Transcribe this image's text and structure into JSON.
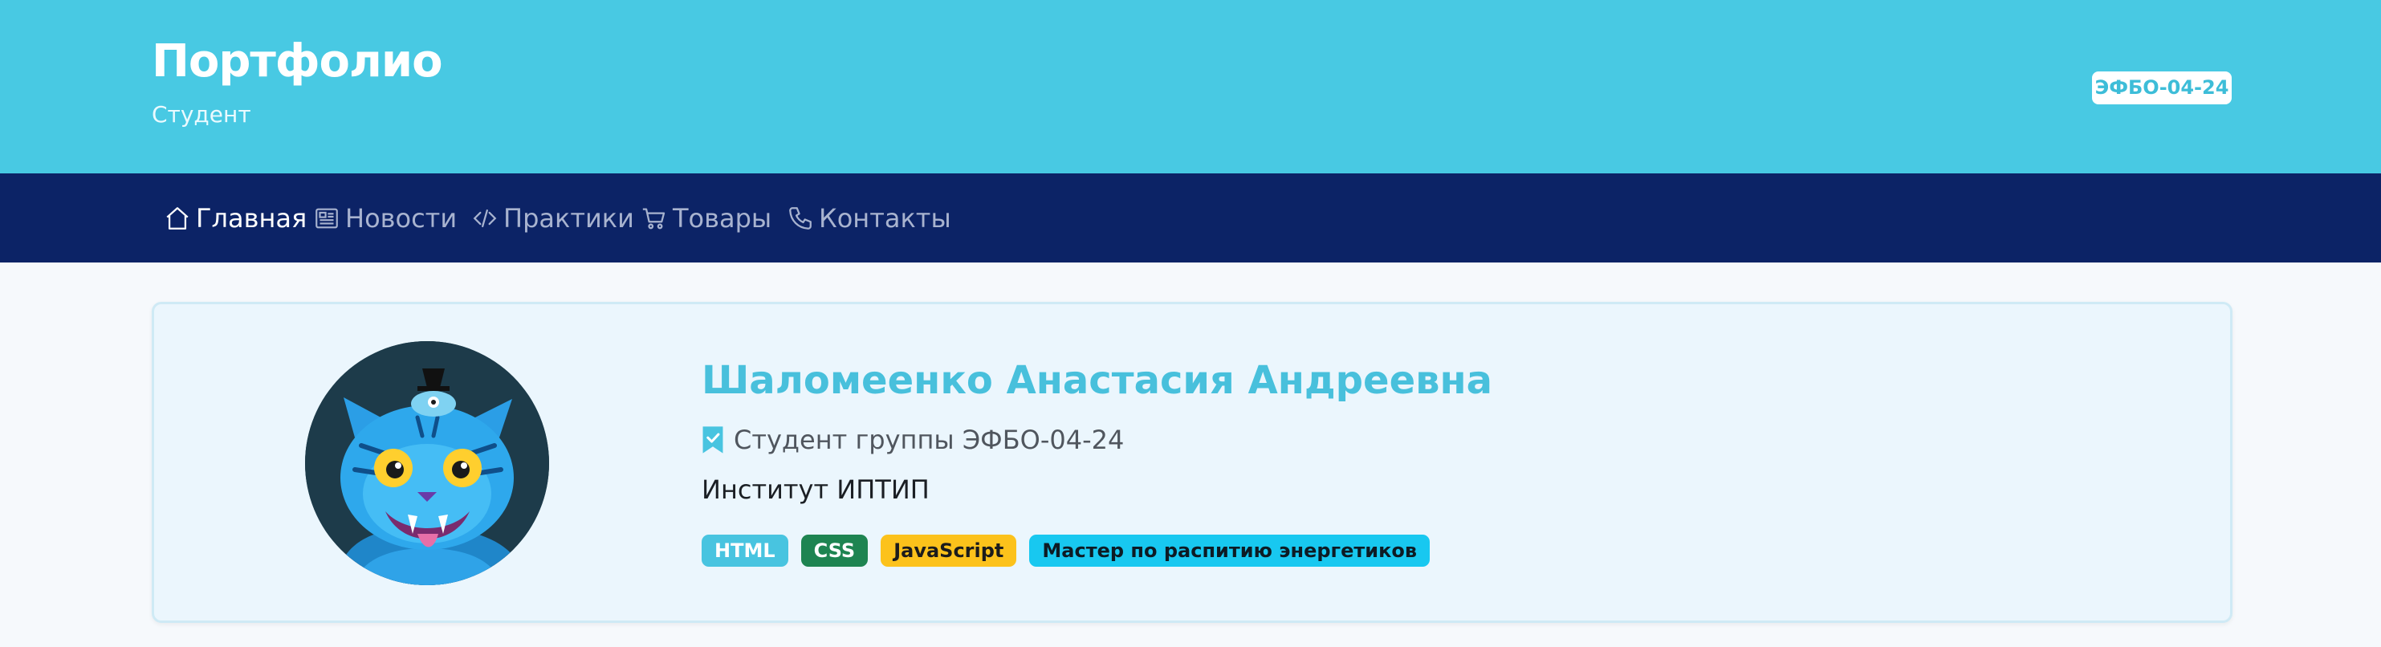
{
  "header": {
    "title": "Портфолио",
    "subtitle": "Студент",
    "group_badge": "ЭФБО-04-24"
  },
  "nav": {
    "items": [
      {
        "label": "Главная",
        "icon": "home-icon",
        "active": true
      },
      {
        "label": "Новости",
        "icon": "newspaper-icon",
        "active": false
      },
      {
        "label": "Практики",
        "icon": "code-icon",
        "active": false
      },
      {
        "label": "Товары",
        "icon": "cart-icon",
        "active": false
      },
      {
        "label": "Контакты",
        "icon": "phone-icon",
        "active": false
      }
    ]
  },
  "profile": {
    "name": "Шаломеенко Анастасия Андреевна",
    "group": "Студент группы ЭФБО-04-24",
    "group_icon": "bookmark-check-icon",
    "institute": "Институт ИПТИП",
    "avatar": "blue-tiger-cartoon-avatar",
    "tags": [
      {
        "label": "HTML",
        "bg": "#48c4e0",
        "color": "#ffffff"
      },
      {
        "label": "CSS",
        "bg": "#1e8451",
        "color": "#ffffff"
      },
      {
        "label": "JavaScript",
        "bg": "#fcc21b",
        "color": "#1c1c1c"
      },
      {
        "label": "Мастер по распитию энергетиков",
        "bg": "#18c8f0",
        "color": "#0d1b24"
      }
    ]
  },
  "colors": {
    "header_bg": "#48c9e3",
    "navbar_bg": "#0c2366",
    "card_bg": "#ebf6fd",
    "name_color": "#48c0dc"
  }
}
